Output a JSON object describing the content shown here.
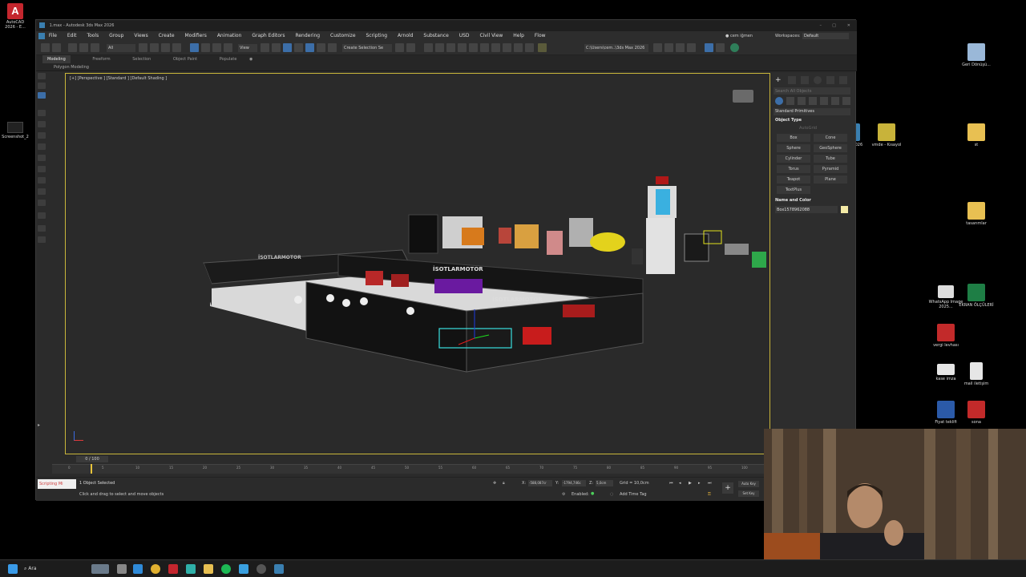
{
  "window": {
    "title": "1.max - Autodesk 3ds Max 2026",
    "workspace_label": "Workspaces:",
    "workspace_value": "Default",
    "user": "cem iğmen"
  },
  "menu": [
    "File",
    "Edit",
    "Tools",
    "Group",
    "Views",
    "Create",
    "Modifiers",
    "Animation",
    "Graph Editors",
    "Rendering",
    "Customize",
    "Scripting",
    "Arnold",
    "Substance",
    "USD",
    "Civil View",
    "Help",
    "Flow"
  ],
  "toolbar": {
    "selection_filter": "All",
    "view_dropdown": "View",
    "named_selection": "Create Selection Se",
    "path": "C:\\Users\\cem..\\3ds Max 2026"
  },
  "ribbon": {
    "tabs": [
      "Modeling",
      "Freeform",
      "Selection",
      "Object Paint",
      "Populate"
    ],
    "sub": "Polygon Modeling"
  },
  "viewport": {
    "label": "[+] [Perspective ] [Standard ] [Default Shading ]",
    "brand_text": "İSOTLARMOTOR"
  },
  "command_panel": {
    "search_placeholder": "Search All Objects",
    "category": "Standard Primitives",
    "object_type_header": "Object Type",
    "autogrid": "AutoGrid",
    "buttons": [
      "Box",
      "Cone",
      "Sphere",
      "GeoSphere",
      "Cylinder",
      "Tube",
      "Torus",
      "Pyramid",
      "Teapot",
      "Plane",
      "TextPlus"
    ],
    "name_color_header": "Name and Color",
    "object_name": "Box1578962088"
  },
  "timeline": {
    "frame_label": "0 / 100",
    "ticks": [
      "0",
      "5",
      "10",
      "15",
      "20",
      "25",
      "30",
      "35",
      "40",
      "45",
      "50",
      "55",
      "60",
      "65",
      "70",
      "75",
      "80",
      "85",
      "90",
      "95",
      "100"
    ]
  },
  "status": {
    "script_label": "Scripting Mi",
    "selection": "1 Object Selected",
    "hint": "Click and drag to select and move objects",
    "x_label": "X:",
    "x_value": "-588,087cr",
    "y_label": "Y:",
    "y_value": "-1794,746c",
    "z_label": "Z:",
    "z_value": "5,0cm",
    "grid": "Grid = 10,0cm",
    "enabled": "Enabled:",
    "add_time_tag": "Add Time Tag",
    "auto_key": "Auto Key",
    "set_key": "Set Key"
  },
  "desktop": {
    "autocad_label": "AutoCAD 2026 - E...",
    "screenshot_label": "Screenshot_2",
    "icons": [
      {
        "label": "Geri Dönüşü...",
        "color": "#9ab8d8"
      },
      {
        "label": "st",
        "color": "#e8c052"
      },
      {
        "label": "tasarımlar",
        "color": "#e8c052"
      },
      {
        "label": "WhatsApp Image 2025...",
        "color": "#dddddd"
      },
      {
        "label": "EKRAN ÖLÇÜLERİ",
        "color": "#1e7e45"
      },
      {
        "label": "vergi levhası",
        "color": "#c22a2a"
      },
      {
        "label": "kase imza",
        "color": "#e6e6e6"
      },
      {
        "label": "mail iletişim",
        "color": "#e6e6e6"
      },
      {
        "label": "Fiyat teklifi",
        "color": "#2b5aa8"
      },
      {
        "label": "sona",
        "color": "#c22a2a"
      },
      {
        "label": "vmde - Kısayol",
        "color": "#c8b33a"
      },
      {
        "label": "ax 2026",
        "color": "#3a7fb0"
      }
    ]
  },
  "taskbar": {
    "search_label": "Ara"
  },
  "colors": {
    "accent_blue": "#3c6ea8",
    "viewport_border": "#c9b63a",
    "panel_bg": "#2d2d2d"
  }
}
